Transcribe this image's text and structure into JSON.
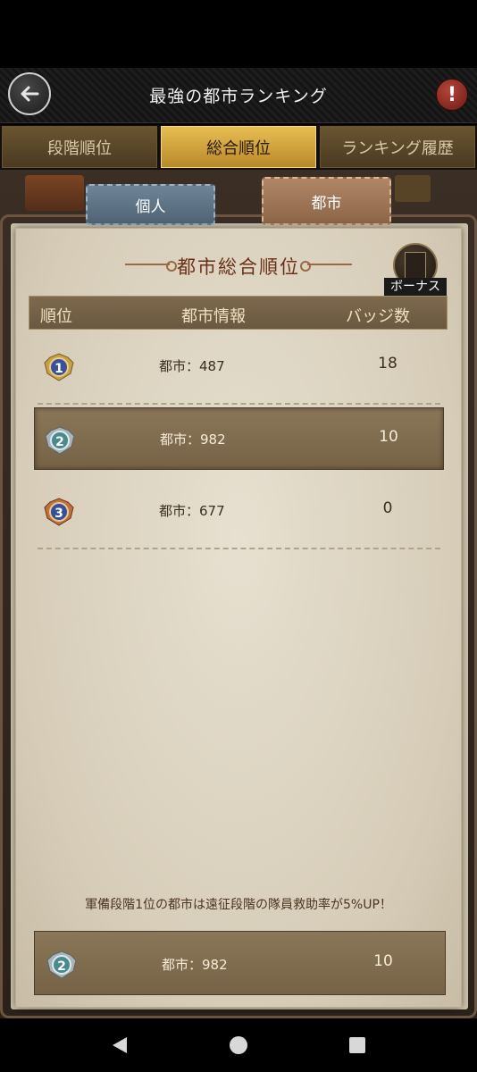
{
  "header": {
    "title": "最強の都市ランキング"
  },
  "tabs": [
    {
      "label": "段階順位",
      "active": false
    },
    {
      "label": "総合順位",
      "active": true
    },
    {
      "label": "ランキング履歴",
      "active": false
    }
  ],
  "subtabs": {
    "individual": "個人",
    "city": "都市"
  },
  "section": {
    "title": "都市総合順位",
    "bonus_label": "ボーナス"
  },
  "columns": {
    "rank": "順位",
    "city_info": "都市情報",
    "badges": "バッジ数"
  },
  "rows": [
    {
      "rank": "1",
      "city": "都市：487",
      "badges": "18",
      "badge_color": "#3b4f9c"
    },
    {
      "rank": "2",
      "city": "都市：982",
      "badges": "10",
      "badge_color": "#4a8a8c"
    },
    {
      "rank": "3",
      "city": "都市：677",
      "badges": "0",
      "badge_color": "#34509a"
    }
  ],
  "notice": "軍備段階1位の都市は遠征段階の隊員救助率が5%UP！",
  "my_row": {
    "rank": "2",
    "city": "都市：982",
    "badges": "10"
  }
}
